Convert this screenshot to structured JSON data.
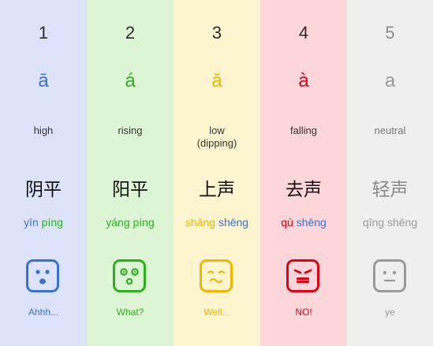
{
  "colors": {
    "tone1": "#3b6fd6",
    "tone2": "#2cb11e",
    "tone3": "#f2b600",
    "tone4": "#e10016",
    "tone5": "#9a9a9a"
  },
  "tones": [
    {
      "number": "1",
      "mark": "ā",
      "description": "high",
      "description2": "",
      "hanzi": "阴平",
      "pinyin_a": "yīn",
      "pinyin_b": "píng",
      "face_icon": "surprised-face-icon",
      "exclamation": "Ahhh..."
    },
    {
      "number": "2",
      "mark": "á",
      "description": "rising",
      "description2": "",
      "hanzi": "阳平",
      "pinyin_a": "yáng",
      "pinyin_b": "píng",
      "face_icon": "questioning-face-icon",
      "exclamation": "What?"
    },
    {
      "number": "3",
      "mark": "ǎ",
      "description": "low",
      "description2": "(dipping)",
      "hanzi": "上声",
      "pinyin_a": "shǎng",
      "pinyin_b": "shēng",
      "face_icon": "hesitant-face-icon",
      "exclamation": "Well..."
    },
    {
      "number": "4",
      "mark": "à",
      "description": "falling",
      "description2": "",
      "hanzi": "去声",
      "pinyin_a": "qù",
      "pinyin_b": "shēng",
      "face_icon": "angry-face-icon",
      "exclamation": "NO!"
    },
    {
      "number": "5",
      "mark": "a",
      "description": "neutral",
      "description2": "",
      "hanzi": "轻声",
      "pinyin_a": "qīng",
      "pinyin_b": "shēng",
      "face_icon": "neutral-face-icon",
      "exclamation": "ye"
    }
  ]
}
